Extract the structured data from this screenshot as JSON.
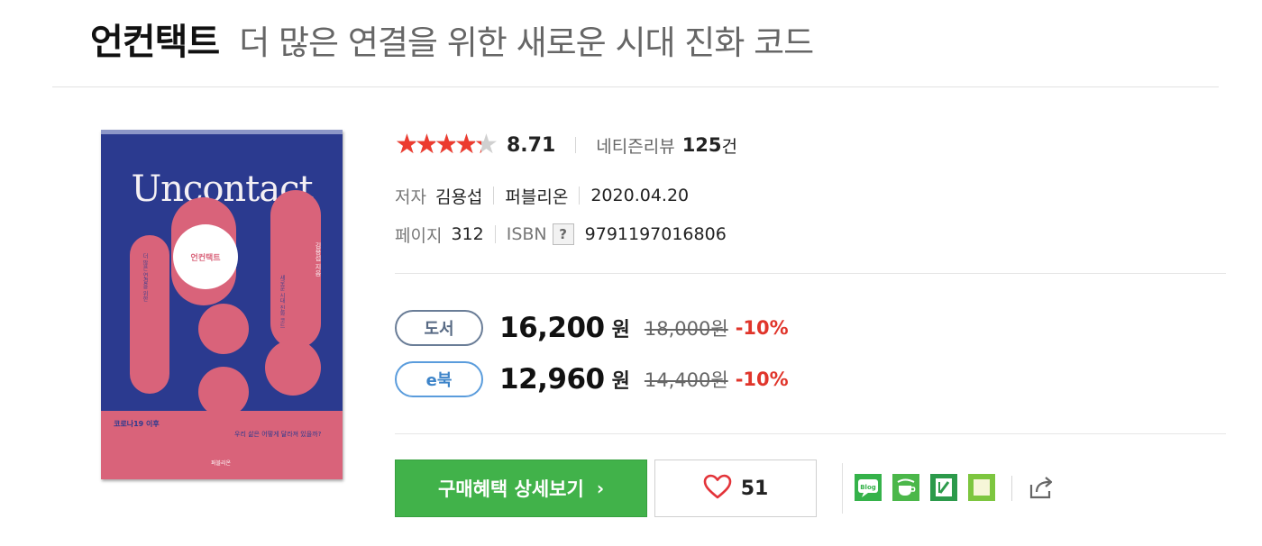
{
  "title": {
    "main": "언컨택트",
    "sub": "더 많은 연결을 위한 새로운 시대 진화 코드"
  },
  "cover": {
    "title": "Uncontact",
    "badge": "언컨택트",
    "author_vertical": "김용섭 지음",
    "vertical_text_1": "더 많은 연결을 위한",
    "vertical_text_2": "새로운 시대 진화 코드",
    "subtitle_1": "코로나19 이후",
    "subtitle_2": "우리 삶은 어떻게 달라져 있을까?",
    "publisher": "퍼블리온"
  },
  "rating": {
    "stars_fraction": 0.87,
    "score": "8.71",
    "review_label": "네티즌리뷰",
    "review_count": "125",
    "review_unit": "건",
    "accent_color": "#ec3b2f"
  },
  "meta": {
    "author_label": "저자",
    "author": "김용섭",
    "publisher": "퍼블리온",
    "date": "2020.04.20",
    "pages_label": "페이지",
    "pages": "312",
    "isbn_label": "ISBN",
    "isbn_help": "?",
    "isbn": "9791197016806"
  },
  "prices": {
    "book": {
      "label": "도서",
      "price": "16,200",
      "unit": "원",
      "original": "18,000원",
      "discount": "-10%"
    },
    "ebook": {
      "label": "e북",
      "price": "12,960",
      "unit": "원",
      "original": "14,400원",
      "discount": "-10%"
    },
    "discount_color": "#e0352b"
  },
  "actions": {
    "buy_label": "구매혜택 상세보기",
    "buy_chevron": "›",
    "buy_color": "#41b24a",
    "like_count": "51"
  },
  "share": {
    "blog_label": "Blog",
    "icons": [
      "blog-icon",
      "cafe-icon",
      "post-icon",
      "memo-icon",
      "share-icon"
    ]
  }
}
